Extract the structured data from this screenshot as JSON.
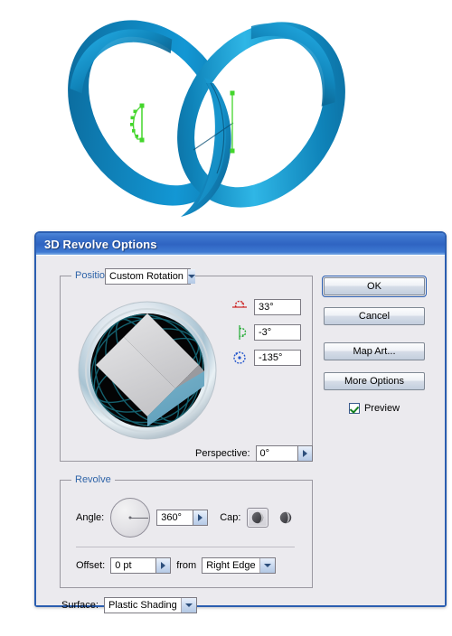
{
  "artwork": {
    "name": "3d-revolved-rings-artwork",
    "description": "Two interlocking blue revolved rings forming a heart shape with selected green vector paths",
    "ring_color_light": "#1e9ad6",
    "ring_color_mid": "#0f7db5",
    "ring_color_dark": "#0a5f8e",
    "path_color": "#44d62c"
  },
  "dialog": {
    "title": "3D Revolve Options",
    "position_group": {
      "title": "Position:",
      "preset_value": "Custom Rotation",
      "rotation_axes": [
        {
          "icon": "rotate-x-axis-icon",
          "color": "#cc2222",
          "value": "33°"
        },
        {
          "icon": "rotate-y-axis-icon",
          "color": "#22aa33",
          "value": "-3°"
        },
        {
          "icon": "rotate-z-axis-icon",
          "color": "#2255cc",
          "value": "-135°"
        }
      ],
      "perspective_label": "Perspective:",
      "perspective_value": "0°"
    },
    "revolve_group": {
      "title": "Revolve",
      "angle_label": "Angle:",
      "angle_value": "360°",
      "cap_label": "Cap:",
      "cap_on_icon": "cap-on-icon",
      "cap_off_icon": "cap-off-icon",
      "offset_label": "Offset:",
      "offset_value": "0 pt",
      "from_label": "from",
      "from_value": "Right Edge"
    },
    "surface": {
      "label": "Surface:",
      "value": "Plastic Shading"
    },
    "buttons": {
      "ok": "OK",
      "cancel": "Cancel",
      "map_art": "Map Art...",
      "more_options": "More Options"
    },
    "preview": {
      "label": "Preview",
      "checked": true
    }
  },
  "colors": {
    "titlebar_blue": "#2f64c2",
    "dialog_border": "#2b5eb0",
    "dialog_bg": "#ebeaee",
    "group_label": "#2f64a8",
    "trackcube_face_top": "#d2d2d4",
    "trackcube_face_front": "#6aa9c4",
    "trackcube_sphere": "#000000"
  }
}
